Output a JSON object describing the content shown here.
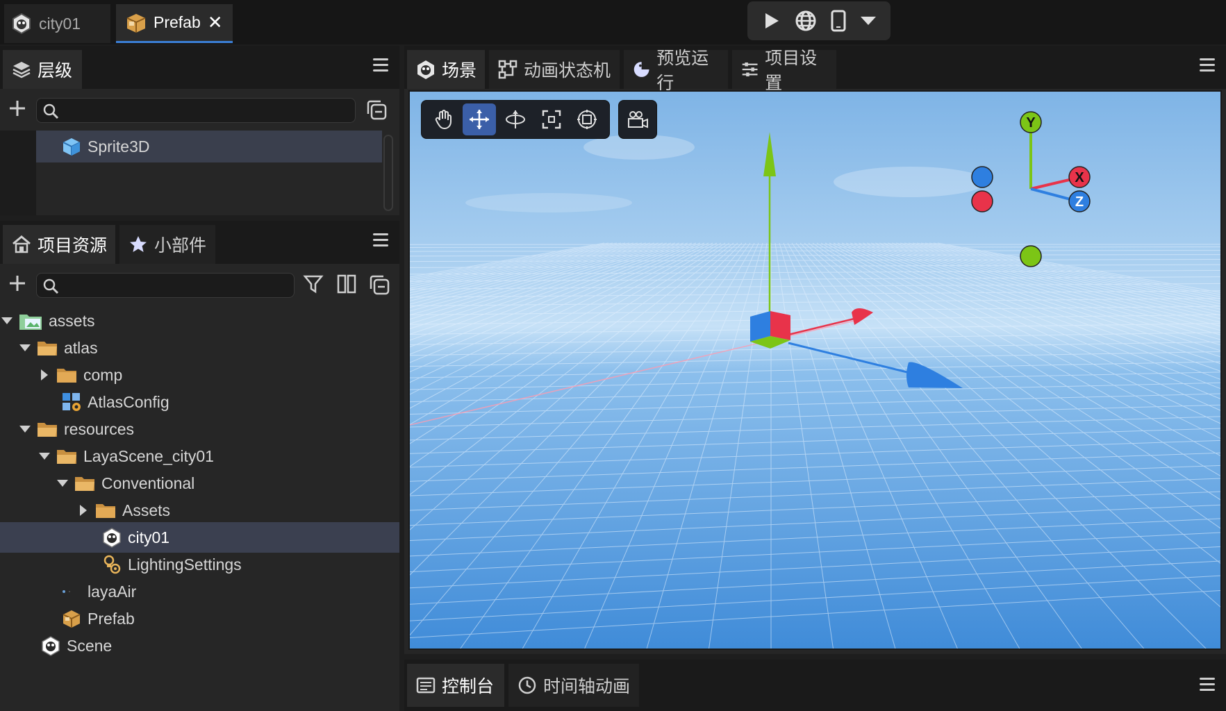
{
  "doc_tabs": [
    {
      "label": "city01",
      "icon": "scene-icon",
      "active": false
    },
    {
      "label": "Prefab",
      "icon": "prefab-box-icon",
      "active": true
    }
  ],
  "run_controls": [
    "play-icon",
    "globe-icon",
    "phone-icon",
    "chevron-down-icon"
  ],
  "hierarchy": {
    "tab_label": "层级",
    "search_placeholder": "",
    "items": [
      {
        "label": "Sprite3D",
        "icon": "cube-icon",
        "selected": true
      }
    ]
  },
  "assets_panel": {
    "tabs": [
      {
        "label": "项目资源",
        "icon": "house-icon"
      },
      {
        "label": "小部件",
        "icon": "star-icon"
      }
    ],
    "search_placeholder": "",
    "tree": [
      {
        "label": "assets",
        "depth": 0,
        "expanded": true,
        "kind": "assets-folder"
      },
      {
        "label": "atlas",
        "depth": 1,
        "expanded": true,
        "kind": "folder"
      },
      {
        "label": "comp",
        "depth": 2,
        "expanded": false,
        "kind": "folder"
      },
      {
        "label": "AtlasConfig",
        "depth": 2,
        "kind": "atlas-config"
      },
      {
        "label": "resources",
        "depth": 1,
        "expanded": true,
        "kind": "folder"
      },
      {
        "label": "LayaScene_city01",
        "depth": 2,
        "expanded": true,
        "kind": "folder"
      },
      {
        "label": "Conventional",
        "depth": 3,
        "expanded": true,
        "kind": "folder"
      },
      {
        "label": "Assets",
        "depth": 4,
        "expanded": false,
        "kind": "folder"
      },
      {
        "label": "city01",
        "depth": 4,
        "kind": "scene",
        "selected": true
      },
      {
        "label": "LightingSettings",
        "depth": 4,
        "kind": "lighting"
      },
      {
        "label": "layaAir",
        "depth": 2,
        "kind": "dot"
      },
      {
        "label": "Prefab",
        "depth": 2,
        "kind": "prefab"
      },
      {
        "label": "Scene",
        "depth": 1,
        "kind": "scene"
      }
    ]
  },
  "scene_panel": {
    "tabs": [
      {
        "label": "场景",
        "icon": "scene-icon",
        "active": true
      },
      {
        "label": "动画状态机",
        "icon": "state-machine-icon",
        "active": false
      },
      {
        "label": "预览运行",
        "icon": "preview-icon",
        "active": false
      },
      {
        "label": "项目设置",
        "icon": "sliders-icon",
        "active": false
      }
    ],
    "tools": [
      "hand-icon",
      "move-icon",
      "rotate-icon",
      "scale-icon",
      "rect-icon"
    ],
    "active_tool": "move-icon",
    "gizmo_labels": {
      "x": "X",
      "y": "Y",
      "z": "Z"
    }
  },
  "console_panel": {
    "tabs": [
      {
        "label": "控制台",
        "icon": "console-icon",
        "active": true
      },
      {
        "label": "时间轴动画",
        "icon": "clock-icon",
        "active": false
      }
    ]
  },
  "colors": {
    "accent": "#3b7fd6",
    "axis_x": "#e8334a",
    "axis_y": "#7cc516",
    "axis_z": "#2e7fe0",
    "folder": "#e8b45a"
  }
}
